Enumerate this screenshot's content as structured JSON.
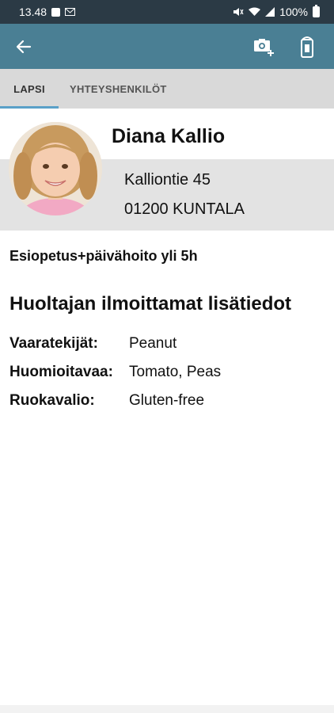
{
  "status_bar": {
    "time": "13.48",
    "battery": "100%"
  },
  "tabs": [
    {
      "label": "LAPSI",
      "active": true
    },
    {
      "label": "YHTEYSHENKILÖT",
      "active": false
    }
  ],
  "child": {
    "name": "Diana Kallio",
    "address_line1": "Kalliontie 45",
    "address_line2": "01200 KUNTALA",
    "service": "Esiopetus+päivähoito yli 5h"
  },
  "guardian_info": {
    "title": "Huoltajan ilmoittamat lisätiedot",
    "rows": [
      {
        "label": "Vaaratekijät:",
        "value": "Peanut"
      },
      {
        "label": "Huomioitavaa:",
        "value": "Tomato, Peas"
      },
      {
        "label": "Ruokavalio:",
        "value": "Gluten-free"
      }
    ]
  },
  "colors": {
    "status_bar": "#2b3a45",
    "app_bar": "#4a7f94",
    "tab_bar": "#d9d9d9",
    "tab_indicator": "#5aa0c8",
    "header_band": "#e3e3e3"
  },
  "icons": {
    "back": "arrow-left-icon",
    "add_photo": "camera-plus-icon",
    "nfc": "nfc-phone-icon"
  }
}
